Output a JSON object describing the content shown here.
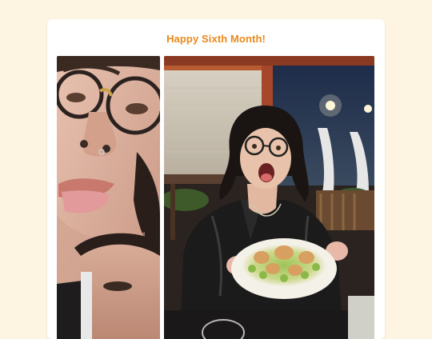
{
  "post": {
    "title": "Happy Sixth Month!"
  },
  "photos": [
    {
      "name": "selfie-closeup-photo"
    },
    {
      "name": "dinner-restaurant-photo"
    }
  ],
  "colors": {
    "background": "#fdf5e1",
    "card": "#ffffff",
    "title": "#e8891c"
  }
}
